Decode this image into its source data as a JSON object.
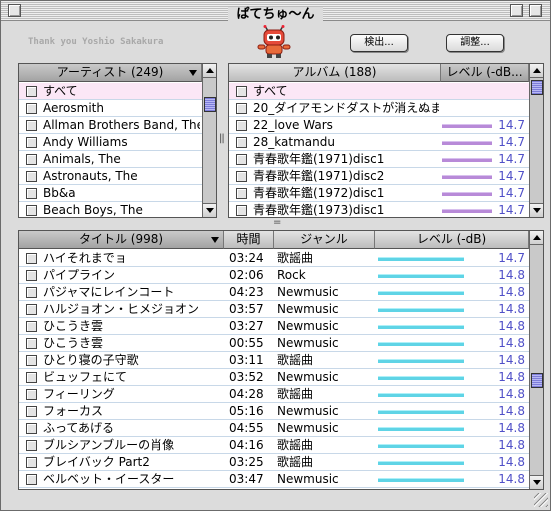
{
  "window": {
    "title": "ぱてちゅ〜ん"
  },
  "toolbar": {
    "credit": "Thank you Yoshio Sakakura",
    "search_label": "検出...",
    "adjust_label": "調整...",
    "mascot_icon": "robot-mascot-icon"
  },
  "artist_panel": {
    "header": "アーティスト (249)",
    "items": [
      "すべて",
      "Aerosmith",
      "Allman Brothers Band, The",
      "Andy Williams",
      "Animals, The",
      "Astronauts, The",
      "Bb&a",
      "Beach Boys, The"
    ]
  },
  "album_panel": {
    "header_album": "アルバム (188)",
    "header_level": "レベル (-dB...",
    "items": [
      {
        "name": "すべて",
        "level": ""
      },
      {
        "name": "20_ダイアモンドダストが消えぬま...",
        "level": ""
      },
      {
        "name": "22_love Wars",
        "level": "14.7"
      },
      {
        "name": "28_katmandu",
        "level": "14.7"
      },
      {
        "name": "青春歌年鑑(1971)disc1",
        "level": "14.7"
      },
      {
        "name": "青春歌年鑑(1971)disc2",
        "level": "14.7"
      },
      {
        "name": "青春歌年鑑(1972)disc1",
        "level": "14.7"
      },
      {
        "name": "青春歌年鑑(1973)disc1",
        "level": "14.7"
      }
    ]
  },
  "track_panel": {
    "header_title": "タイトル (998)",
    "header_time": "時間",
    "header_genre": "ジャンル",
    "header_level": "レベル (-dB)",
    "rows": [
      {
        "title": "ハイそれまでョ",
        "time": "03:24",
        "genre": "歌謡曲",
        "level": "14.7"
      },
      {
        "title": "パイプライン",
        "time": "02:06",
        "genre": "Rock",
        "level": "14.8"
      },
      {
        "title": "パジャマにレインコート",
        "time": "04:23",
        "genre": "Newmusic",
        "level": "14.8"
      },
      {
        "title": "ハルジョオン・ヒメジョオン",
        "time": "03:57",
        "genre": "Newmusic",
        "level": "14.8"
      },
      {
        "title": "ひこうき雲",
        "time": "03:27",
        "genre": "Newmusic",
        "level": "14.8"
      },
      {
        "title": "ひこうき雲",
        "time": "00:55",
        "genre": "Newmusic",
        "level": "14.8"
      },
      {
        "title": "ひとり寝の子守歌",
        "time": "03:11",
        "genre": "歌謡曲",
        "level": "14.8"
      },
      {
        "title": "ビュッフェにて",
        "time": "03:52",
        "genre": "Newmusic",
        "level": "14.8"
      },
      {
        "title": "フィーリング",
        "time": "04:28",
        "genre": "歌謡曲",
        "level": "14.8"
      },
      {
        "title": "フォーカス",
        "time": "05:16",
        "genre": "Newmusic",
        "level": "14.8"
      },
      {
        "title": "ふってあげる",
        "time": "04:55",
        "genre": "Newmusic",
        "level": "14.8"
      },
      {
        "title": "ブルシアンブルーの肖像",
        "time": "04:16",
        "genre": "歌謡曲",
        "level": "14.8"
      },
      {
        "title": "ブレイバック Part2",
        "time": "03:25",
        "genre": "歌謡曲",
        "level": "14.8"
      },
      {
        "title": "ベルベット・イースター",
        "time": "03:47",
        "genre": "Newmusic",
        "level": "14.8"
      }
    ]
  },
  "colors": {
    "selected_row": "#fbe7f6",
    "level_text": "#5050c8",
    "album_level_bar": "#b88ad8",
    "track_level_bar": "#5fd4e6",
    "scroll_thumb": "#7d7dd9"
  }
}
